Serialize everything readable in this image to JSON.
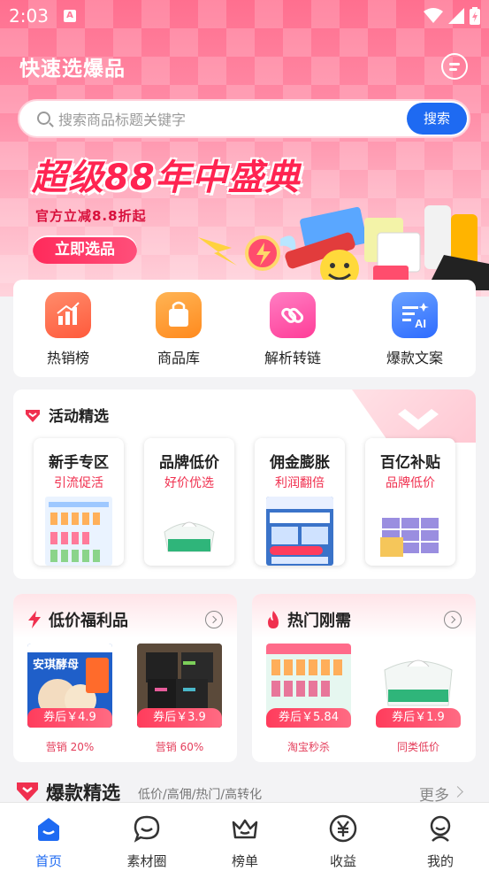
{
  "status_bar": {
    "time": "2:03",
    "notification_icon": "A"
  },
  "header": {
    "app_title": "快速选爆品",
    "chat_icon": "message-icon"
  },
  "search": {
    "placeholder": "搜索商品标题关键字",
    "button_label": "搜索"
  },
  "banner": {
    "title": "超级88年中盛典",
    "subtitle": "官方立减8.8折起",
    "cta_label": "立即选品"
  },
  "tools": [
    {
      "label": "热销榜",
      "icon": "bar-chart-icon",
      "color": "#ff6a4a"
    },
    {
      "label": "商品库",
      "icon": "shopping-bag-icon",
      "color": "#ff9a2e"
    },
    {
      "label": "解析转链",
      "icon": "link-icon",
      "color": "#ff4fa8"
    },
    {
      "label": "爆款文案",
      "icon": "ai-text-icon",
      "color": "#3d7bff"
    }
  ],
  "activity": {
    "title": "活动精选",
    "cards": [
      {
        "title": "新手专区",
        "subtitle": "引流促活"
      },
      {
        "title": "品牌低价",
        "subtitle": "好价优选"
      },
      {
        "title": "佣金膨胀",
        "subtitle": "利润翻倍"
      },
      {
        "title": "百亿补贴",
        "subtitle": "品牌低价"
      }
    ]
  },
  "low_price": {
    "title": "低价福利品",
    "products": [
      {
        "price": "券后￥4.9",
        "caption": "营销 20%",
        "img_label": "安琪酵母"
      },
      {
        "price": "券后￥3.9",
        "caption": "营销 60%"
      }
    ]
  },
  "hot_need": {
    "title": "热门刚需",
    "products": [
      {
        "price": "券后￥5.84",
        "caption": "淘宝秒杀"
      },
      {
        "price": "券后￥1.9",
        "caption": "同类低价"
      }
    ]
  },
  "hot_picks": {
    "title": "爆款精选",
    "tags": "低价/高佣/热门/高转化",
    "more_label": "更多"
  },
  "tabbar": [
    {
      "label": "首页",
      "icon": "home-icon",
      "active": true
    },
    {
      "label": "素材圈",
      "icon": "chat-bubble-icon",
      "active": false
    },
    {
      "label": "榜单",
      "icon": "crown-icon",
      "active": false
    },
    {
      "label": "收益",
      "icon": "yen-coin-icon",
      "active": false
    },
    {
      "label": "我的",
      "icon": "profile-icon",
      "active": false
    }
  ],
  "colors": {
    "brand_pink": "#ff2451",
    "accent_blue": "#1e6af2",
    "price_red": "#ff3c5c"
  }
}
